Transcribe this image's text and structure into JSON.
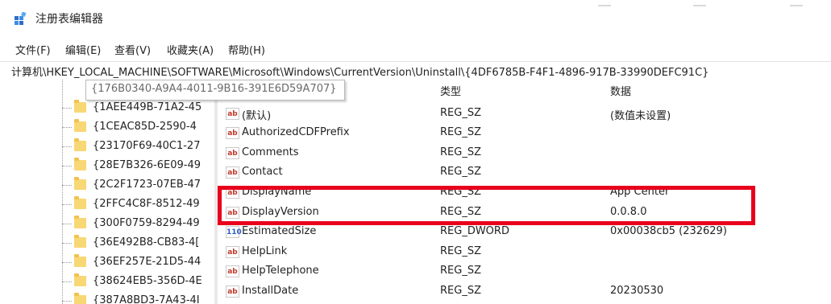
{
  "window": {
    "title": "注册表编辑器"
  },
  "menu": [
    "文件(F)",
    "编辑(E)",
    "查看(V)",
    "收藏夹(A)",
    "帮助(H)"
  ],
  "address": "计算机\\HKEY_LOCAL_MACHINE\\SOFTWARE\\Microsoft\\Windows\\CurrentVersion\\Uninstall\\{4DF6785B-F4F1-4896-917B-33990DEFC91C}",
  "tooltip": "{176B0340-A9A4-4011-9B16-391E6D59A707}",
  "tree": [
    "{1AEE449B-71A2-45",
    "{1CEAC85D-2590-4",
    "{23170F69-40C1-27",
    "{28E7B326-6E09-49",
    "{2C2F1723-07EB-47",
    "{2FFC4C8F-8512-49",
    "{300F0759-8294-49",
    "{36E492B8-CB83-4[",
    "{36EF257E-21D5-44",
    "{38624EB5-356D-4E",
    "{387A8BD3-7A43-4I"
  ],
  "columns": {
    "type": "类型",
    "data": "数据"
  },
  "values": [
    {
      "name": "(默认)",
      "type": "REG_SZ",
      "data": "(数值未设置)",
      "icon": "string-value-icon"
    },
    {
      "name": "AuthorizedCDFPrefix",
      "type": "REG_SZ",
      "data": "",
      "icon": "string-value-icon"
    },
    {
      "name": "Comments",
      "type": "REG_SZ",
      "data": "",
      "icon": "string-value-icon"
    },
    {
      "name": "Contact",
      "type": "REG_SZ",
      "data": "",
      "icon": "string-value-icon"
    },
    {
      "name": "DisplayName",
      "type": "REG_SZ",
      "data": "App Center",
      "icon": "string-value-icon"
    },
    {
      "name": "DisplayVersion",
      "type": "REG_SZ",
      "data": "0.0.8.0",
      "icon": "string-value-icon"
    },
    {
      "name": "EstimatedSize",
      "type": "REG_DWORD",
      "data": "0x00038cb5 (232629)",
      "icon": "binary-value-icon"
    },
    {
      "name": "HelpLink",
      "type": "REG_SZ",
      "data": "",
      "icon": "string-value-icon"
    },
    {
      "name": "HelpTelephone",
      "type": "REG_SZ",
      "data": "",
      "icon": "string-value-icon"
    },
    {
      "name": "InstallDate",
      "type": "REG_SZ",
      "data": "20230530",
      "icon": "string-value-icon"
    }
  ],
  "icons": {
    "string": "ab",
    "binary": "110"
  },
  "colors": {
    "highlight": "#e8001c",
    "folder": "#f8d775"
  }
}
